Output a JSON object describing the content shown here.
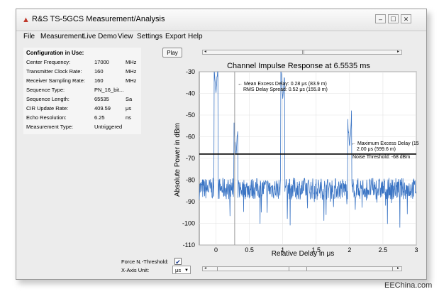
{
  "window": {
    "title": "R&S TS-5GCS Measurement/Analysis"
  },
  "menu": [
    "File",
    "Measurement",
    "Live Demo",
    "View",
    "Settings",
    "Export",
    "Help"
  ],
  "config": {
    "title": "Configuration in Use:",
    "rows": [
      {
        "label": "Center Frequency:",
        "value": "17000",
        "unit": "MHz"
      },
      {
        "label": "Transmitter Clock Rate:",
        "value": "160",
        "unit": "MHz"
      },
      {
        "label": "Receiver Sampling Rate:",
        "value": "160",
        "unit": "MHz"
      },
      {
        "label": "Sequence Type:",
        "value": "PN_16_bit...",
        "unit": ""
      },
      {
        "label": "Sequence Length:",
        "value": "65535",
        "unit": "Sa"
      },
      {
        "label": "CIR Update Rate:",
        "value": "409.59",
        "unit": "μs"
      },
      {
        "label": "Echo Resolution:",
        "value": "6.25",
        "unit": "ns"
      },
      {
        "label": "Measurement Type:",
        "value": "Untriggered",
        "unit": ""
      }
    ]
  },
  "controls": {
    "play_label": "Play",
    "force_threshold_label": "Force N.-Threshold:",
    "force_threshold_checked": true,
    "x_axis_unit_label": "X-Axis Unit:",
    "x_axis_unit_value": "μs"
  },
  "watermark": "EEChina.com",
  "chart_data": {
    "type": "line",
    "title": "Channel Impulse Response at 6.5535 ms",
    "xlabel": "Relative Delay in μs",
    "ylabel": "Absolute Power in dBm",
    "xlim": [
      -0.25,
      3
    ],
    "ylim": [
      -110,
      -30
    ],
    "xticks": [
      "0",
      "0.5",
      "1",
      "1.5",
      "2",
      "2.5",
      "3"
    ],
    "yticks": [
      "-30",
      "-40",
      "-50",
      "-60",
      "-70",
      "-80",
      "-90",
      "-100",
      "-110"
    ],
    "noise_threshold": -68,
    "mean_excess_marker_x": 0.28,
    "series": [
      {
        "color": "#3a74c4",
        "peaks": [
          {
            "x": 0.0,
            "y": -40
          },
          {
            "x": 1.0,
            "y": -43
          },
          {
            "x": 2.0,
            "y": -65
          },
          {
            "x": 0.3,
            "y": -69
          }
        ],
        "noise_floor": -84
      }
    ],
    "annotations": [
      {
        "text": "← Mean Excess Delay: 0.28 μs (83.9 m)"
      },
      {
        "text": "RMS Delay Spread: 0.52 μs (155.8 m)"
      },
      {
        "text": "← Maximum Excess Delay (15"
      },
      {
        "text": "2.00 μs (599.6 m)"
      },
      {
        "text": "Noise Threshold: -68 dBm"
      }
    ]
  }
}
